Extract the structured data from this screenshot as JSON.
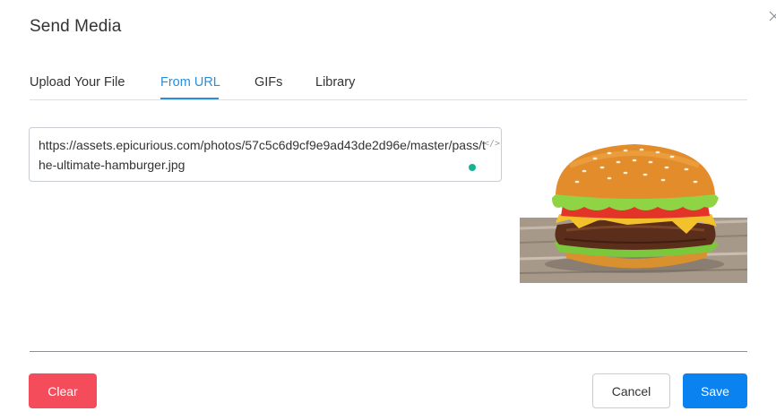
{
  "dialog": {
    "title": "Send Media"
  },
  "tabs": [
    {
      "label": "Upload Your File",
      "active": false
    },
    {
      "label": "From URL",
      "active": true
    },
    {
      "label": "GIFs",
      "active": false
    },
    {
      "label": "Library",
      "active": false
    }
  ],
  "url_input": {
    "value": "https://assets.epicurious.com/photos/57c5c6d9cf9e9ad43de2d96e/master/pass/the-ultimate-hamburger.jpg",
    "code_icon": "</>"
  },
  "preview": {
    "icon": "hamburger-image"
  },
  "buttons": {
    "clear": "Clear",
    "cancel": "Cancel",
    "save": "Save"
  },
  "colors": {
    "accent": "#2a8fd9",
    "clear": "#f44c5b",
    "save": "#0a82f0",
    "status_dot": "#15b394"
  }
}
